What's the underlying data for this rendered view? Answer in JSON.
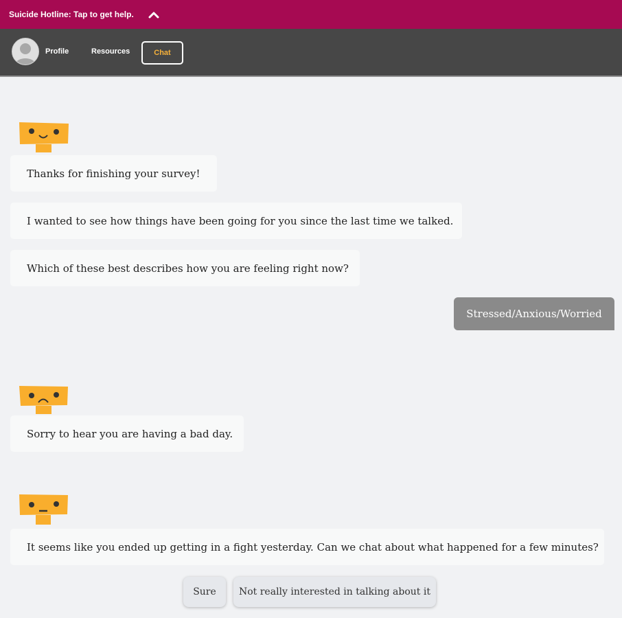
{
  "hotline": {
    "text": "Suicide Hotline: Tap to get help."
  },
  "nav": {
    "profile": "Profile",
    "resources": "Resources",
    "chat": "Chat"
  },
  "messages": [
    {
      "text": "Thanks for finishing your survey!"
    },
    {
      "text": "I wanted to see how things have been going for you since the last time we talked."
    },
    {
      "text": "Which of these best describes how you are feeling right now?"
    },
    {
      "text": "Sorry to hear you are having a bad day."
    },
    {
      "text": "It seems like you ended up getting in a fight yesterday. Can we chat about what happened for a few minutes?"
    }
  ],
  "user_reply": "Stressed/Anxious/Worried",
  "quick_replies": [
    "Sure",
    "Not really interested in talking about it"
  ],
  "colors": {
    "hotline": "#a60a52",
    "nav": "#474747",
    "accent": "#f6b13a",
    "bot": "#f9ae2d",
    "user_bubble": "#8a8a8a"
  }
}
